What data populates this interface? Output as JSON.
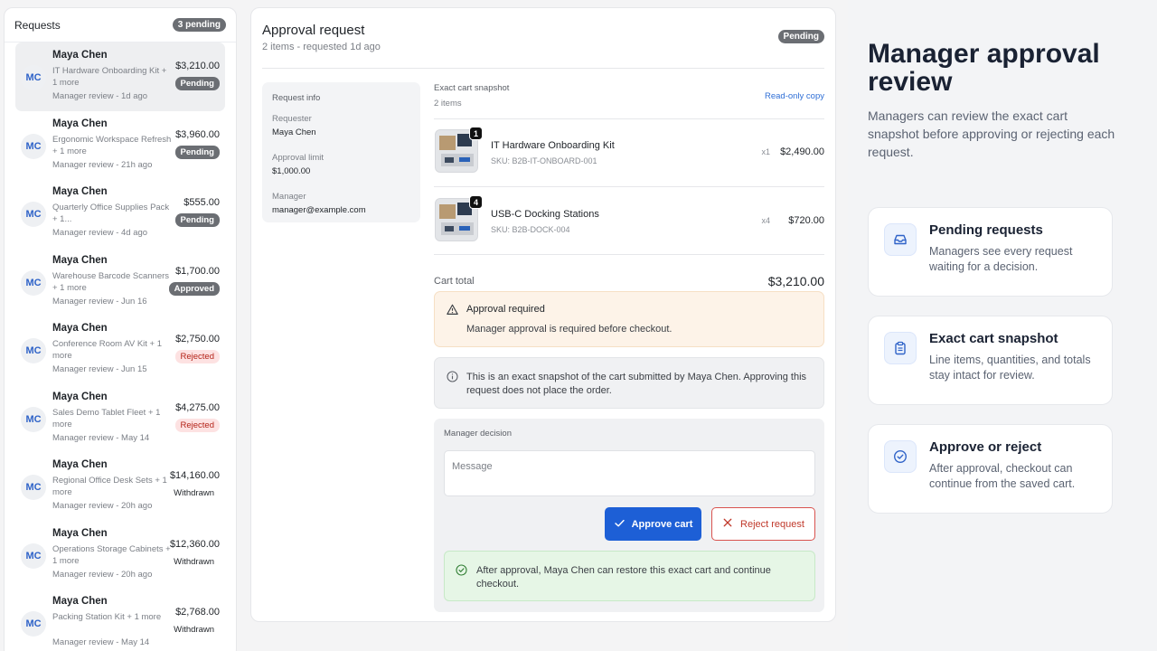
{
  "requests_panel": {
    "title": "Requests",
    "pending_badge": "3 pending",
    "items": [
      {
        "initials": "MC",
        "name": "Maya Chen",
        "desc": "IT Hardware Onboarding Kit + 1 more",
        "meta": "Manager review - 1d ago",
        "amount": "$3,210.00",
        "status": "Pending"
      },
      {
        "initials": "MC",
        "name": "Maya Chen",
        "desc": "Ergonomic Workspace Refresh + 1 more",
        "meta": "Manager review - 21h ago",
        "amount": "$3,960.00",
        "status": "Pending"
      },
      {
        "initials": "MC",
        "name": "Maya Chen",
        "desc": "Quarterly Office Supplies Pack + 1...",
        "meta": "Manager review - 4d ago",
        "amount": "$555.00",
        "status": "Pending"
      },
      {
        "initials": "MC",
        "name": "Maya Chen",
        "desc": "Warehouse Barcode Scanners + 1 more",
        "meta": "Manager review - Jun 16",
        "amount": "$1,700.00",
        "status": "Approved"
      },
      {
        "initials": "MC",
        "name": "Maya Chen",
        "desc": "Conference Room AV Kit + 1 more",
        "meta": "Manager review - Jun 15",
        "amount": "$2,750.00",
        "status": "Rejected"
      },
      {
        "initials": "MC",
        "name": "Maya Chen",
        "desc": "Sales Demo Tablet Fleet + 1 more",
        "meta": "Manager review - May 14",
        "amount": "$4,275.00",
        "status": "Rejected"
      },
      {
        "initials": "MC",
        "name": "Maya Chen",
        "desc": "Regional Office Desk Sets + 1 more",
        "meta": "Manager review - 20h ago",
        "amount": "$14,160.00",
        "status": "Withdrawn"
      },
      {
        "initials": "MC",
        "name": "Maya Chen",
        "desc": "Operations Storage Cabinets + 1 more",
        "meta": "Manager review - 20h ago",
        "amount": "$12,360.00",
        "status": "Withdrawn"
      },
      {
        "initials": "MC",
        "name": "Maya Chen",
        "desc": "Packing Station Kit + 1 more",
        "meta": "Manager review - May 14",
        "amount": "$2,768.00",
        "status": "Withdrawn"
      }
    ]
  },
  "detail": {
    "title": "Approval request",
    "subtitle": "2 items - requested 1d ago",
    "status": "Pending",
    "info": {
      "title": "Request info",
      "requester_label": "Requester",
      "requester": "Maya Chen",
      "limit_label": "Approval limit",
      "limit": "$1,000.00",
      "manager_label": "Manager",
      "manager": "manager@example.com"
    },
    "cart": {
      "title": "Exact cart snapshot",
      "count": "2 items",
      "link": "Read-only copy",
      "items": [
        {
          "qty_badge": "1",
          "name": "IT Hardware Onboarding Kit",
          "sku": "SKU: B2B-IT-ONBOARD-001",
          "qty": "x1",
          "price": "$2,490.00"
        },
        {
          "qty_badge": "4",
          "name": "USB-C Docking Stations",
          "sku": "SKU: B2B-DOCK-004",
          "qty": "x4",
          "price": "$720.00"
        }
      ],
      "total_label": "Cart total",
      "total": "$3,210.00"
    },
    "warning": {
      "title": "Approval required",
      "text": "Manager approval is required before checkout."
    },
    "note": "This is an exact snapshot of the cart submitted by Maya Chen. Approving this request does not place the order.",
    "decision": {
      "label": "Manager decision",
      "placeholder": "Message",
      "approve": "Approve cart",
      "reject": "Reject request",
      "success": "After approval, Maya Chen can restore this exact cart and continue checkout."
    }
  },
  "marketing": {
    "heading": "Manager approval review",
    "subtitle": "Managers can review the exact cart snapshot before approving or rejecting each request.",
    "features": [
      {
        "icon": "inbox-icon",
        "title": "Pending requests",
        "desc": "Managers see every request waiting for a decision."
      },
      {
        "icon": "clipboard-icon",
        "title": "Exact cart snapshot",
        "desc": "Line items, quantities, and totals stay intact for review."
      },
      {
        "icon": "check-circle-icon",
        "title": "Approve or reject",
        "desc": "After approval, checkout can continue from the saved cart."
      }
    ]
  },
  "colors": {
    "primary": "#1d5fd6",
    "danger": "#d9534f",
    "warning_bg": "#fdf3e8",
    "success_bg": "#e6f6e6"
  }
}
